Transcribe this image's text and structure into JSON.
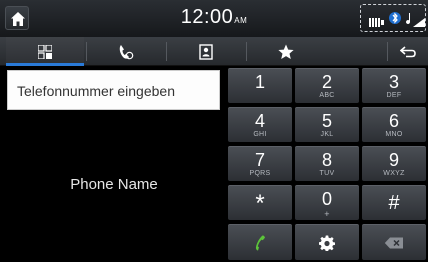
{
  "status": {
    "time": "12:00",
    "ampm": "AM"
  },
  "tabs": [
    {
      "name": "tab-dial",
      "icon": "dial-pad-icon",
      "active": true
    },
    {
      "name": "tab-recent-calls",
      "icon": "recent-calls-icon",
      "active": false
    },
    {
      "name": "tab-contacts",
      "icon": "contacts-icon",
      "active": false
    },
    {
      "name": "tab-favorites",
      "icon": "star-icon",
      "active": false
    },
    {
      "name": "tab-back",
      "icon": "back-arrow-icon",
      "active": false
    }
  ],
  "left": {
    "input_placeholder": "Telefonnummer eingeben",
    "phone_name": "Phone Name"
  },
  "keypad": [
    {
      "num": "1",
      "sub": ""
    },
    {
      "num": "2",
      "sub": "ABC"
    },
    {
      "num": "3",
      "sub": "DEF"
    },
    {
      "num": "4",
      "sub": "GHI"
    },
    {
      "num": "5",
      "sub": "JKL"
    },
    {
      "num": "6",
      "sub": "MNO"
    },
    {
      "num": "7",
      "sub": "PQRS"
    },
    {
      "num": "8",
      "sub": "TUV"
    },
    {
      "num": "9",
      "sub": "WXYZ"
    },
    {
      "num": "*",
      "sub": ""
    },
    {
      "num": "0",
      "sub": "+"
    },
    {
      "num": "#",
      "sub": ""
    }
  ],
  "colors": {
    "accent": "#2a7ad8",
    "call_green": "#5cc43a"
  }
}
